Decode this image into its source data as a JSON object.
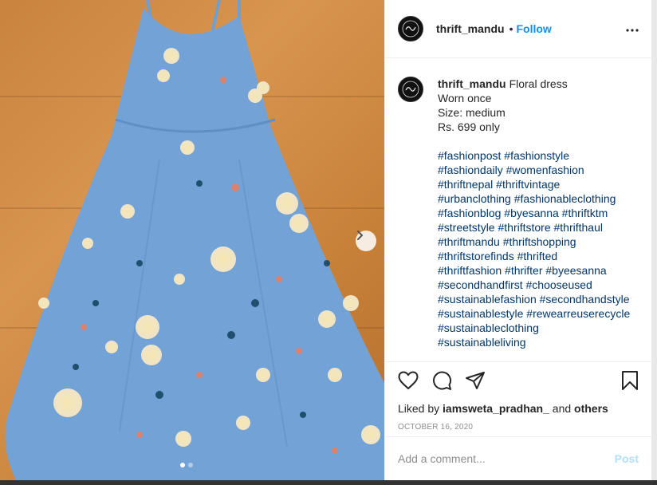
{
  "post": {
    "username": "thrift_mandu",
    "follow_label": "Follow",
    "separator": "•",
    "caption_lines": [
      "Floral dress",
      "Worn once",
      "Size: medium",
      "Rs. 699 only"
    ],
    "hashtag_lines": [
      "#fashionpost #fashionstyle",
      "#fashiondaily #womenfashion",
      "#thriftnepal #thriftvintage",
      "#urbanclothing #fashionableclothing",
      "#fashionblog #byesanna #thriftktm",
      "#streetstyle #thriftstore #thrifthaul",
      "#thriftmandu #thriftshopping",
      "#thriftstorefinds #thrifted",
      "#thriftfashion #thrifter #byeesanna",
      "#secondhandfirst #chooseused",
      "#sustainablefashion #secondhandstyle",
      "#sustainablestyle #rewearreuserecycle",
      "#sustainableclothing",
      "#sustainableliving"
    ],
    "liked_by_prefix": "Liked by",
    "liked_by_user": "iamsweta_pradhan_",
    "liked_by_and": "and",
    "liked_by_others": "others",
    "date": "OCTOBER 16, 2020"
  },
  "comment": {
    "placeholder": "Add a comment...",
    "post_label": "Post"
  },
  "icons": {
    "like": "heart-icon",
    "comment": "comment-icon",
    "share": "share-icon",
    "save": "bookmark-icon",
    "more": "more-options-icon",
    "next": "chevron-right-icon"
  },
  "carousel": {
    "slide": 1,
    "total": 2
  },
  "colors": {
    "accent": "#0095f6",
    "link": "#00376b",
    "muted": "#8e8e8e",
    "post_disabled": "#b2dffc"
  }
}
